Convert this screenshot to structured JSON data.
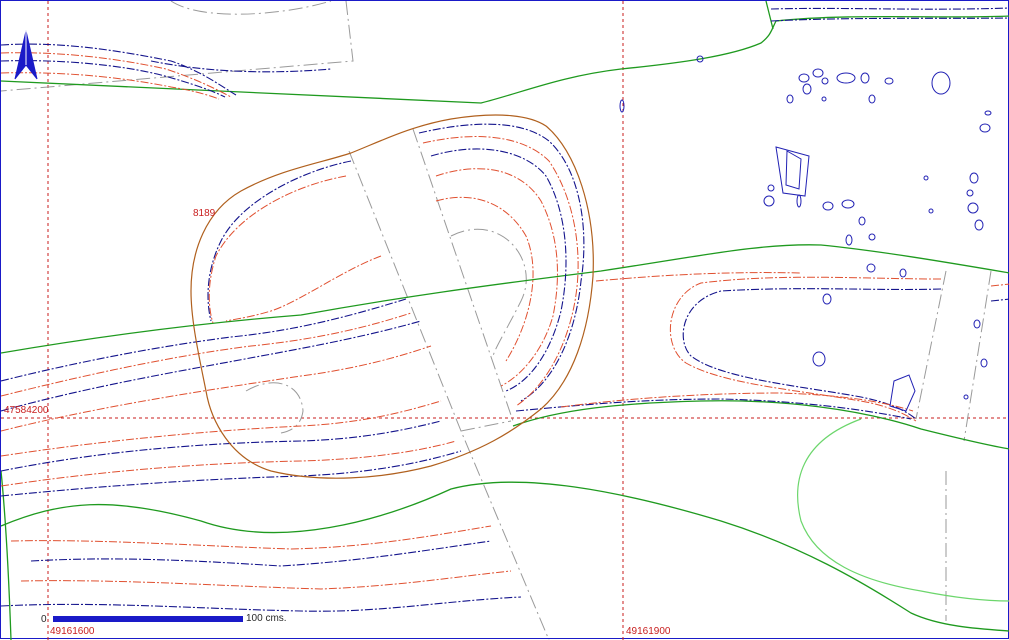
{
  "map": {
    "feature_label": "8189",
    "coord_northing": "47584200",
    "coord_easting_left": "49161600",
    "coord_easting_right": "49161900",
    "scale_start": "0",
    "scale_end_label": "100 cms.",
    "north_arrow_icon": "north-arrow-icon"
  },
  "colors": {
    "frame": "#1a1ac8",
    "grid": "#c81e1e",
    "contour_blue": "#14148c",
    "contour_red": "#e05030",
    "green_line": "#1f9a1f",
    "light_green": "#6cd66c",
    "feature_outline": "#b0601e",
    "cut_lines": "#9a9a9a",
    "scale_bar": "#1a1ac8"
  }
}
